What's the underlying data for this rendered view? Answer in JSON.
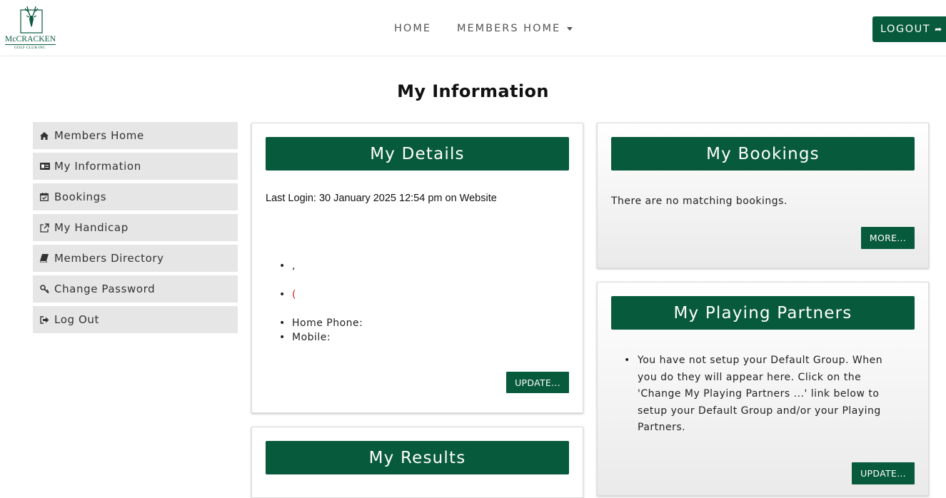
{
  "brand": {
    "logo_name": "McCRACKEN",
    "logo_sub": "GOLF CLUB INC",
    "accent_color": "#085a3c"
  },
  "nav": {
    "home": "HOME",
    "members_home": "MEMBERS HOME",
    "logout": "LOGOUT"
  },
  "page": {
    "title": "My Information"
  },
  "sidebar": {
    "items": [
      {
        "label": "Members Home",
        "icon": "home-icon"
      },
      {
        "label": "My Information",
        "icon": "id-card-icon"
      },
      {
        "label": "Bookings",
        "icon": "calendar-check-icon"
      },
      {
        "label": "My Handicap",
        "icon": "external-link-icon"
      },
      {
        "label": "Members Directory",
        "icon": "book-icon"
      },
      {
        "label": "Change Password",
        "icon": "key-icon"
      },
      {
        "label": "Log Out",
        "icon": "logout-icon"
      }
    ]
  },
  "details": {
    "title": "My Details",
    "last_login": "Last Login: 30 January 2025 12:54 pm on Website",
    "bullet1": ",",
    "bullet2": "(",
    "home_phone": "Home Phone:",
    "mobile": "Mobile:",
    "update": "UPDATE..."
  },
  "bookings": {
    "title": "My Bookings",
    "message": "There are no matching bookings.",
    "more": "MORE..."
  },
  "partners": {
    "title": "My Playing Partners",
    "message": "You have not setup your Default Group. When you do they will appear here. Click on the 'Change My Playing Partners ...' link below to setup your Default Group and/or your Playing Partners.",
    "update": "UPDATE..."
  },
  "results": {
    "title": "My Results"
  }
}
